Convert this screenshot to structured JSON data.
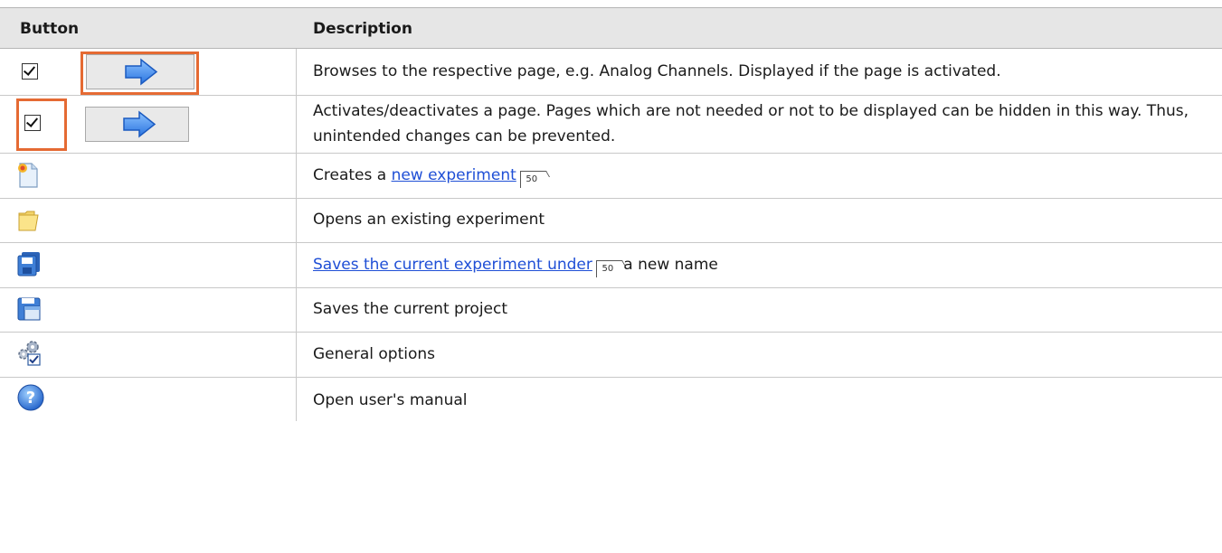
{
  "table": {
    "headers": {
      "button": "Button",
      "description": "Description"
    },
    "rows": [
      {
        "icon": "arrow-button",
        "text": "Browses to the respective page, e.g. Analog Channels. Displayed if the page is activated."
      },
      {
        "icon": "activate-checkbox",
        "text": "Activates/deactivates a page. Pages which are not needed or not to be displayed can be hidden in this way. Thus, unintended changes can be prevented."
      },
      {
        "icon": "new-document-icon",
        "pre": "Creates a ",
        "link": "new experiment",
        "ref": "50",
        "post": ""
      },
      {
        "icon": "open-folder-icon",
        "text": "Opens an existing experiment"
      },
      {
        "icon": "save-as-disk-icon",
        "pre": "",
        "link": "Saves the current experiment under",
        "ref": "50",
        "post": " a new name"
      },
      {
        "icon": "save-project-icon",
        "text": "Saves the current project"
      },
      {
        "icon": "gear-options-icon",
        "text": "General options"
      },
      {
        "icon": "help-icon",
        "text": "Open user's manual"
      }
    ]
  },
  "colors": {
    "highlight": "#e56a33",
    "link": "#1f4fd6",
    "header_bg": "#e6e6e6"
  }
}
